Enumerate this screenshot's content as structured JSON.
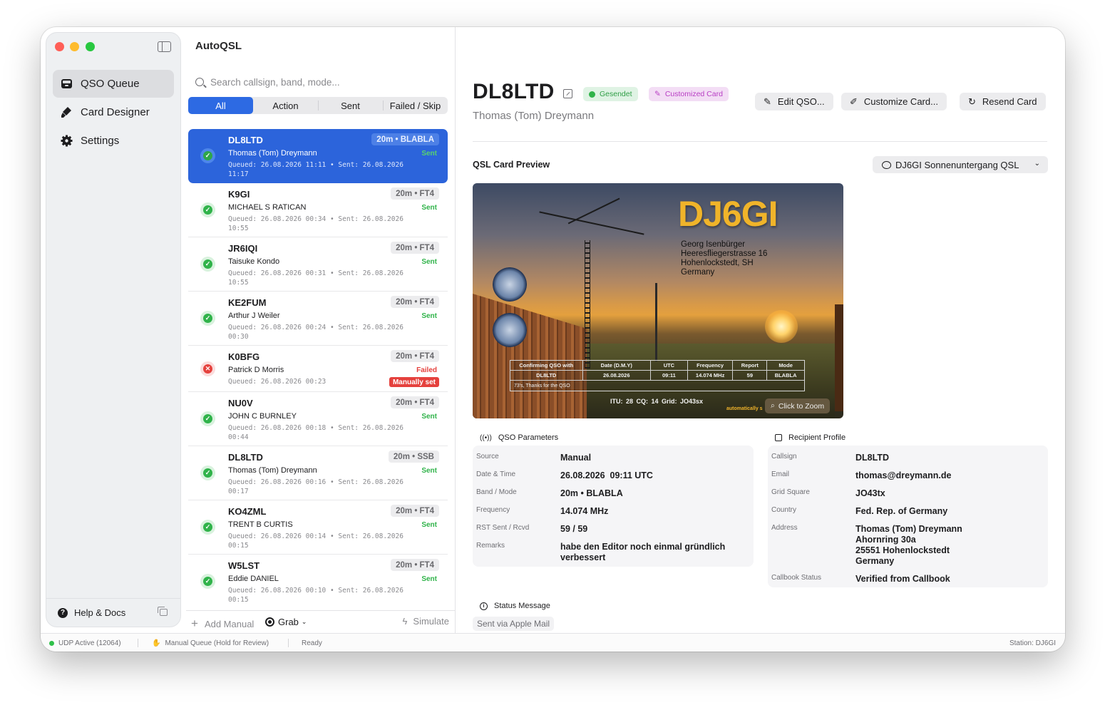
{
  "app": {
    "title": "AutoQSL"
  },
  "sidebar": {
    "items": [
      {
        "label": "QSO Queue",
        "icon": "tray-icon",
        "active": true
      },
      {
        "label": "Card Designer",
        "icon": "brush-icon",
        "active": false
      },
      {
        "label": "Settings",
        "icon": "gear-icon",
        "active": false
      }
    ],
    "footer_label": "Help & Docs"
  },
  "queue": {
    "search_placeholder": "Search callsign, band, mode...",
    "filters": [
      "All",
      "Action",
      "Sent",
      "Failed / Skip"
    ],
    "active_filter": "All",
    "rows": [
      {
        "call": "DL8LTD",
        "name": "Thomas (Tom) Dreymann",
        "band": "20m • BLABLA",
        "state": "Sent",
        "meta": "Queued: 26.08.2026 11:11 • Sent: 26.08.2026 11:17",
        "status": "ok",
        "selected": true
      },
      {
        "call": "K9GI",
        "name": "MICHAEL S RATICAN",
        "band": "20m • FT4",
        "state": "Sent",
        "meta": "Queued: 26.08.2026 00:34 • Sent: 26.08.2026 10:55",
        "status": "ok"
      },
      {
        "call": "JR6IQI",
        "name": "Taisuke Kondo",
        "band": "20m • FT4",
        "state": "Sent",
        "meta": "Queued: 26.08.2026 00:31 • Sent: 26.08.2026 10:55",
        "status": "ok"
      },
      {
        "call": "KE2FUM",
        "name": "Arthur J Weiler",
        "band": "20m • FT4",
        "state": "Sent",
        "meta": "Queued: 26.08.2026 00:24 • Sent: 26.08.2026 00:30",
        "status": "ok"
      },
      {
        "call": "K0BFG",
        "name": "Patrick D Morris",
        "band": "20m • FT4",
        "state": "Failed",
        "badge": "Manually set",
        "meta": "Queued: 26.08.2026 00:23",
        "status": "fail"
      },
      {
        "call": "NU0V",
        "name": "JOHN C BURNLEY",
        "band": "20m • FT4",
        "state": "Sent",
        "meta": "Queued: 26.08.2026 00:18 • Sent: 26.08.2026 00:44",
        "status": "ok"
      },
      {
        "call": "DL8LTD",
        "name": "Thomas (Tom) Dreymann",
        "band": "20m • SSB",
        "state": "Sent",
        "meta": "Queued: 26.08.2026 00:16 • Sent: 26.08.2026 00:17",
        "status": "ok"
      },
      {
        "call": "KO4ZML",
        "name": "TRENT B CURTIS",
        "band": "20m • FT4",
        "state": "Sent",
        "meta": "Queued: 26.08.2026 00:14 • Sent: 26.08.2026 00:15",
        "status": "ok"
      },
      {
        "call": "W5LST",
        "name": "Eddie DANIEL",
        "band": "20m • FT4",
        "state": "Sent",
        "meta": "Queued: 26.08.2026 00:10 • Sent: 26.08.2026 00:15",
        "status": "ok"
      }
    ],
    "footer": {
      "add_label": "Add Manual",
      "grab_label": "Grab",
      "simulate_label": "Simulate"
    }
  },
  "detail": {
    "callsign": "DL8LTD",
    "name": "Thomas (Tom) Dreymann",
    "badge_sent": "Gesendet",
    "badge_custom": "Customized Card",
    "buttons": {
      "edit": "Edit QSO...",
      "customize": "Customize Card...",
      "resend": "Resend Card"
    },
    "preview_title": "QSL Card Preview",
    "template": "DJ6GI Sonnenuntergang QSL",
    "card": {
      "call": "DJ6GI",
      "address": [
        "Georg Isenbürger",
        "Heeresfliegerstrasse 16",
        "Hohenlockstedt, SH",
        "Germany"
      ],
      "table_headers": [
        "Confirming QSO with",
        "Date (D.M.Y)",
        "UTC",
        "Frequency",
        "Report",
        "Mode"
      ],
      "table_values": [
        "DL8LTD",
        "26.08.2026",
        "09:11",
        "14.074 MHz",
        "59",
        "BLABLA"
      ],
      "note": "73's, Thanks for the QSO",
      "footer": "ITU: 28   CQ: 14   Grid: JO43sx",
      "auto_text": "automatically s",
      "zoom_label": "Click to Zoom"
    },
    "qso_params": {
      "title": "QSO Parameters",
      "items": [
        {
          "label": "Source",
          "value": "Manual"
        },
        {
          "label": "Date & Time",
          "value": "26.08.2026  09:11 UTC"
        },
        {
          "label": "Band / Mode",
          "value": "20m • BLABLA"
        },
        {
          "label": "Frequency",
          "value": "14.074 MHz"
        },
        {
          "label": "RST Sent / Rcvd",
          "value": "59 / 59"
        },
        {
          "label": "Remarks",
          "value": "habe den Editor noch einmal gründlich verbessert"
        }
      ]
    },
    "recipient": {
      "title": "Recipient Profile",
      "items": [
        {
          "label": "Callsign",
          "value": "DL8LTD"
        },
        {
          "label": "Email",
          "value": "thomas@dreymann.de"
        },
        {
          "label": "Grid Square",
          "value": "JO43tx"
        },
        {
          "label": "Country",
          "value": "Fed. Rep. of Germany"
        },
        {
          "label": "Address",
          "value": "Thomas (Tom) Dreymann\nAhornring 30a\n25551 Hohenlockstedt\nGermany"
        },
        {
          "label": "Callbook Status",
          "value": "Verified from Callbook"
        }
      ]
    },
    "status_message": {
      "title": "Status Message",
      "value": "Sent via Apple Mail"
    }
  },
  "statusbar": {
    "udp": "UDP Active (12064)",
    "queue_mode": "Manual Queue (Hold for Review)",
    "state": "Ready",
    "station": "Station: DJ6GI"
  },
  "colors": {
    "accent": "#2d6ae3",
    "success": "#30b34a",
    "danger": "#e5413d",
    "custom": "#b83ec4",
    "card_call": "#f0b42a"
  }
}
